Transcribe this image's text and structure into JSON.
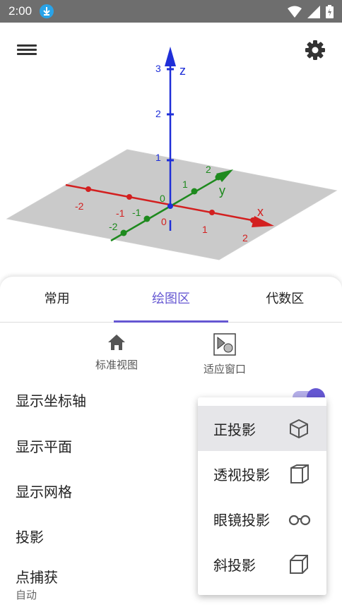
{
  "status_bar": {
    "time": "2:00"
  },
  "graphics": {
    "axis_labels": {
      "x": "x",
      "y": "y",
      "z": "z"
    },
    "z_ticks": [
      "1",
      "2",
      "3"
    ],
    "x_ticks": [
      "-2",
      "-1",
      "0",
      "1",
      "2"
    ],
    "y_ticks": [
      "-2",
      "-1",
      "0",
      "1",
      "2"
    ],
    "colors": {
      "x_axis": "#d32020",
      "y_axis": "#1e8a1e",
      "z_axis": "#1f2fd8"
    }
  },
  "tabs": [
    {
      "label": "常用",
      "active": false
    },
    {
      "label": "绘图区",
      "active": true
    },
    {
      "label": "代数区",
      "active": false
    }
  ],
  "view_buttons": {
    "standard_view": "标准视图",
    "fit_window": "适应窗口"
  },
  "settings": {
    "show_axes": "显示坐标轴",
    "show_plane": "显示平面",
    "show_grid": "显示网格",
    "projection": "投影",
    "point_capture": "点捕获",
    "point_capture_value": "自动"
  },
  "projection_menu": [
    {
      "label": "正投影",
      "icon": "orthographic-cube-icon",
      "selected": true
    },
    {
      "label": "透视投影",
      "icon": "perspective-cube-icon",
      "selected": false
    },
    {
      "label": "眼镜投影",
      "icon": "glasses-icon",
      "selected": false
    },
    {
      "label": "斜投影",
      "icon": "oblique-cube-icon",
      "selected": false
    }
  ]
}
